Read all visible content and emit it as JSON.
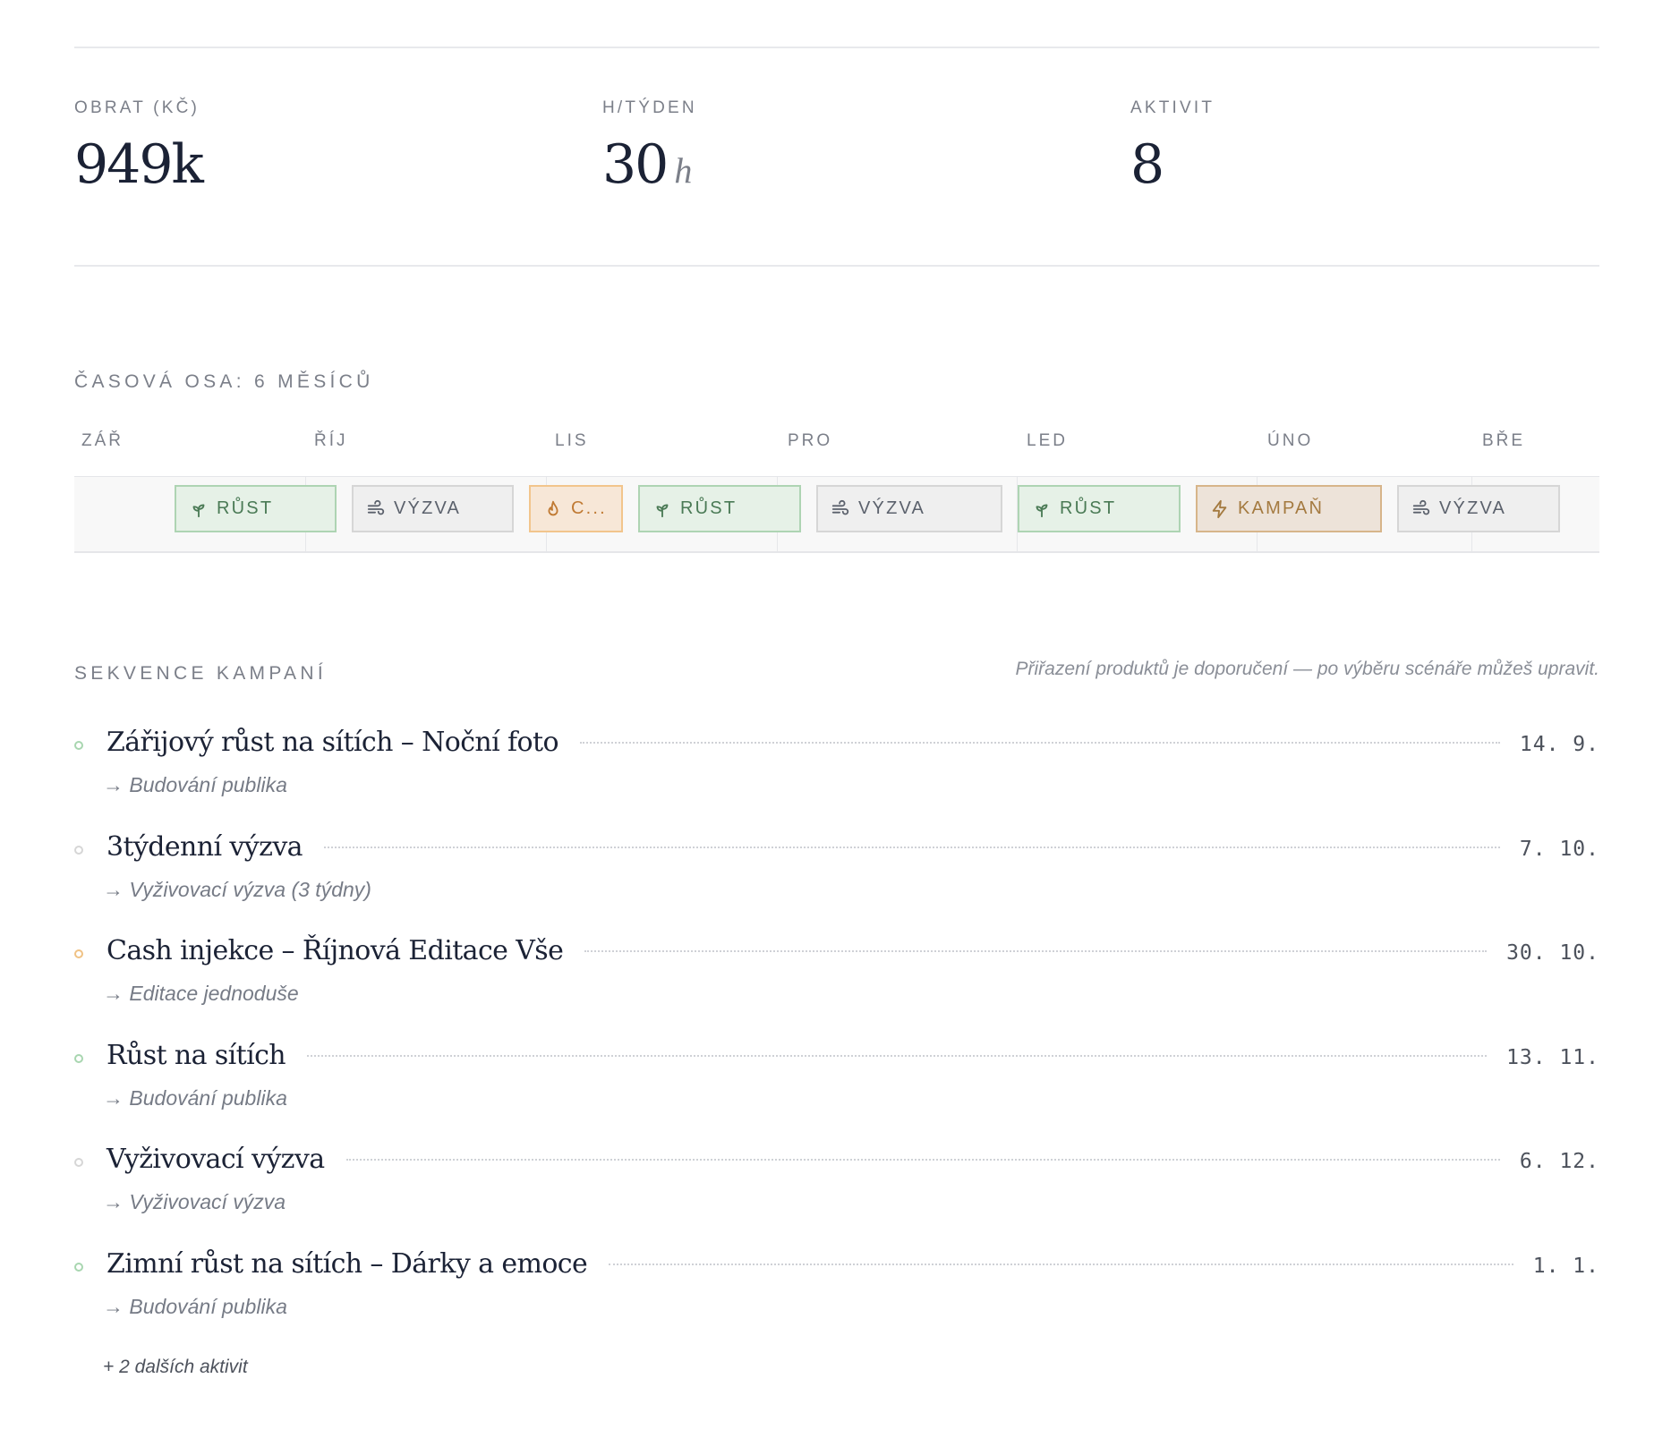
{
  "stats": [
    {
      "label": "OBRAT (KČ)",
      "value": "949k",
      "unit": ""
    },
    {
      "label": "H/TÝDEN",
      "value": "30",
      "unit": "h"
    },
    {
      "label": "AKTIVIT",
      "value": "8",
      "unit": ""
    }
  ],
  "timeline": {
    "title": "ČASOVÁ OSA: 6 MĚSÍCŮ",
    "months": [
      "ZÁŘ",
      "ŘÍJ",
      "LIS",
      "PRO",
      "LED",
      "ÚNO",
      "BŘE"
    ],
    "chips": [
      {
        "label": "RŮST",
        "kind": "growth",
        "icon": "sprout-icon"
      },
      {
        "label": "VÝZVA",
        "kind": "challenge",
        "icon": "wind-icon"
      },
      {
        "label": "C...",
        "kind": "cash",
        "icon": "flame-icon"
      },
      {
        "label": "RŮST",
        "kind": "growth",
        "icon": "sprout-icon"
      },
      {
        "label": "VÝZVA",
        "kind": "challenge",
        "icon": "wind-icon"
      },
      {
        "label": "RŮST",
        "kind": "growth",
        "icon": "sprout-icon"
      },
      {
        "label": "KAMPAŇ",
        "kind": "campaign",
        "icon": "lightning-icon"
      },
      {
        "label": "VÝZVA",
        "kind": "challenge",
        "icon": "wind-icon"
      }
    ]
  },
  "sequence": {
    "title": "SEKVENCE KAMPANÍ",
    "hint": "Přiřazení produktů je doporučení — po výběru scénáře můžeš upravit.",
    "items": [
      {
        "title": "Zářijový růst na sítích – Noční foto",
        "date": "14. 9.",
        "sub": "→ Budování publika",
        "kind": "growth"
      },
      {
        "title": "3týdenní výzva",
        "date": "7. 10.",
        "sub": "→ Vyživovací výzva (3 týdny)",
        "kind": "challenge"
      },
      {
        "title": "Cash injekce – Říjnová Editace Vše",
        "date": "30. 10.",
        "sub": "→ Editace jednoduše",
        "kind": "cash"
      },
      {
        "title": "Růst na sítích",
        "date": "13. 11.",
        "sub": "→ Budování publika",
        "kind": "growth"
      },
      {
        "title": "Vyživovací výzva",
        "date": "6. 12.",
        "sub": "→ Vyživovací výzva",
        "kind": "challenge"
      },
      {
        "title": "Zimní růst na sítích – Dárky a emoce",
        "date": "1. 1.",
        "sub": "→ Budování publika",
        "kind": "growth"
      }
    ],
    "more": "+ 2 dalších aktivit"
  },
  "colors": {
    "growth": "#4a7a55",
    "challenge": "#5b616c",
    "cash": "#c07a33",
    "campaign": "#a47a40"
  }
}
